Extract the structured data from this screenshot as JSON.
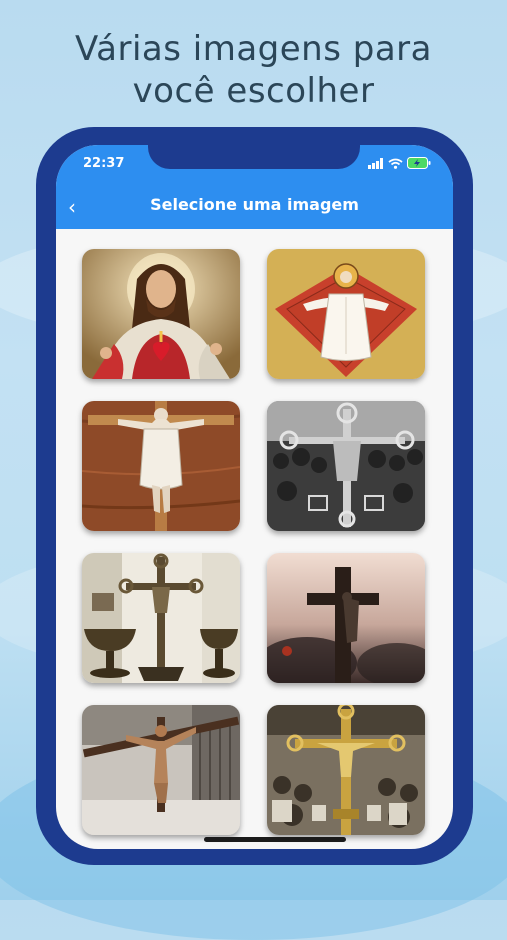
{
  "headline": {
    "line1": "Várias imagens para",
    "line2": "você escolher"
  },
  "status_bar": {
    "time": "22:37",
    "icons": [
      "signal-icon",
      "wifi-icon",
      "battery-charging-icon"
    ]
  },
  "app_bar": {
    "back_icon": "chevron-left-icon",
    "back_glyph": "‹",
    "title": "Selecione uma imagem"
  },
  "images": [
    {
      "name": "sacred-heart-jesus-image"
    },
    {
      "name": "christ-tile-mosaic-image"
    },
    {
      "name": "wooden-cross-christ-image"
    },
    {
      "name": "ornate-crucifix-bw-image"
    },
    {
      "name": "altar-crucifix-chalices-image"
    },
    {
      "name": "crucifix-sunset-image"
    },
    {
      "name": "church-crucifix-image"
    },
    {
      "name": "golden-crucifix-congregation-image"
    }
  ],
  "colors": {
    "phone_frame": "#1d3b8f",
    "app_bar": "#2d8ef0",
    "background": "#c3e1f3",
    "battery": "#4cd964"
  }
}
